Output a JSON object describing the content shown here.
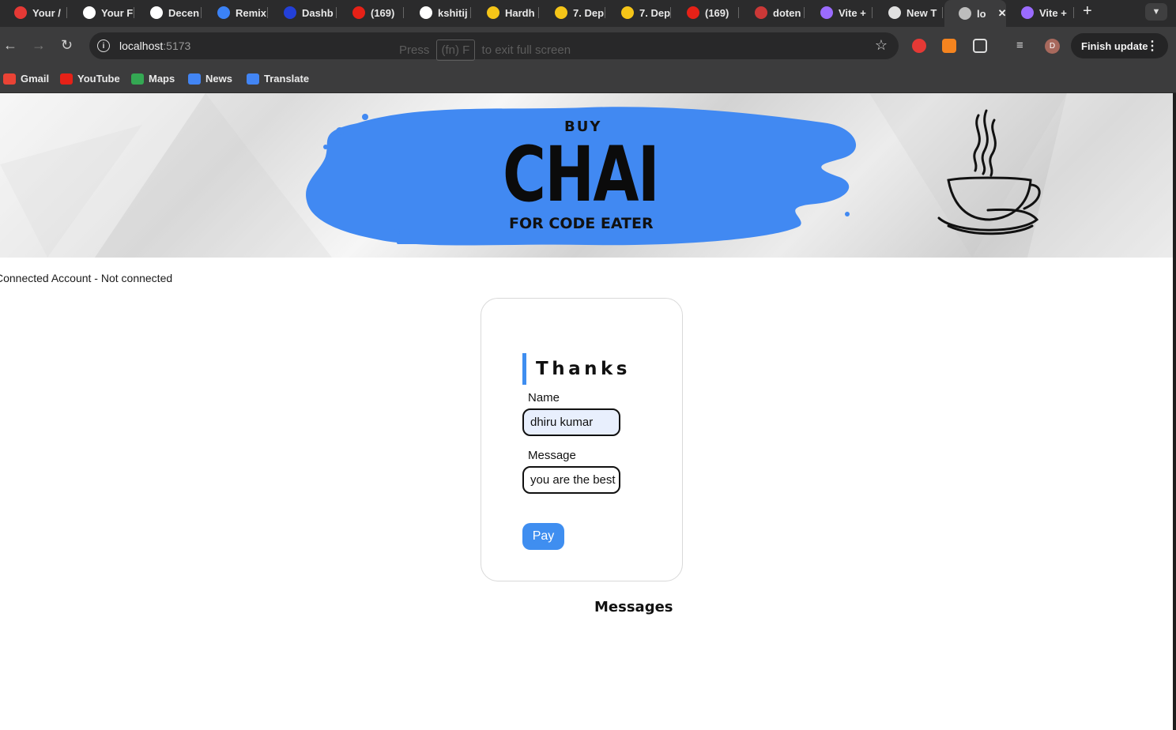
{
  "browser": {
    "tabs": [
      {
        "label": "Your /",
        "icon": "shield-icon",
        "color": "#e53935"
      },
      {
        "label": "Your F",
        "icon": "github-icon",
        "color": "#ffffff"
      },
      {
        "label": "Decen",
        "icon": "github-icon",
        "color": "#ffffff"
      },
      {
        "label": "Remix",
        "icon": "remix-icon",
        "color": "#3b82f6"
      },
      {
        "label": "Dashb",
        "icon": "alchemy-icon",
        "color": "#2340d8"
      },
      {
        "label": "(169)",
        "icon": "youtube-icon",
        "color": "#e62117"
      },
      {
        "label": "kshitij",
        "icon": "github-icon",
        "color": "#ffffff"
      },
      {
        "label": "Hardh",
        "icon": "hardhat-icon",
        "color": "#f5c518"
      },
      {
        "label": "7. Dep",
        "icon": "hardhat-icon",
        "color": "#f5c518"
      },
      {
        "label": "7. Dep",
        "icon": "hardhat-icon",
        "color": "#f5c518"
      },
      {
        "label": "(169)",
        "icon": "youtube-icon",
        "color": "#e62117"
      },
      {
        "label": "doten",
        "icon": "npm-icon",
        "color": "#cb3837"
      },
      {
        "label": "Vite +",
        "icon": "vite-icon",
        "color": "#9b6bff"
      },
      {
        "label": "New T",
        "icon": "chrome-icon",
        "color": "#e0e0e0"
      },
      {
        "label": "lo",
        "icon": "globe-icon",
        "color": "#bdbdbd"
      },
      {
        "label": "Vite +",
        "icon": "vite-icon",
        "color": "#9b6bff"
      }
    ],
    "new_tab": "+",
    "address": {
      "host": "localhost",
      "port": ":5173"
    },
    "fullscreen_hint": {
      "before": "Press",
      "key": "(fn) F",
      "after": "to exit full screen"
    },
    "profile_initial": "D",
    "finish_update": "Finish update",
    "bookmarks": [
      {
        "label": "Gmail",
        "icon": "gmail-icon",
        "color": "#ea4335"
      },
      {
        "label": "YouTube",
        "icon": "youtube-icon",
        "color": "#e62117"
      },
      {
        "label": "Maps",
        "icon": "maps-icon",
        "color": "#34a853"
      },
      {
        "label": "News",
        "icon": "news-icon",
        "color": "#4285f4"
      },
      {
        "label": "Translate",
        "icon": "translate-icon",
        "color": "#4285f4"
      }
    ]
  },
  "page": {
    "banner": {
      "buy": "BUY",
      "chai": "CHAI",
      "subtitle": "FOR CODE EATER"
    },
    "status": "Connected Account - Not connected",
    "form": {
      "title": "Thanks",
      "name_label": "Name",
      "name_value": "dhiru kumar",
      "message_label": "Message",
      "message_value": "you are the best",
      "pay_label": "Pay"
    },
    "messages_heading": "Messages"
  },
  "colors": {
    "accent": "#3f8ef0",
    "splash": "#4189f2"
  }
}
